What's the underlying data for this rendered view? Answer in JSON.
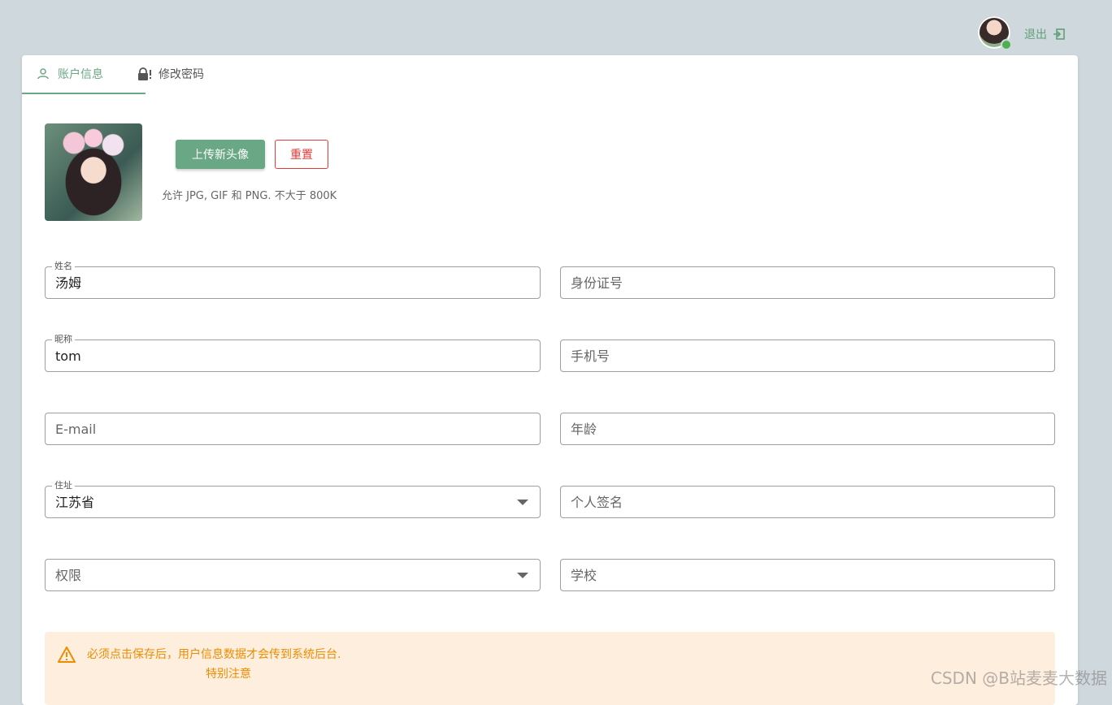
{
  "header": {
    "avatar_icon": "user-avatar",
    "logout_label": "退出",
    "logout_icon": "logout-icon"
  },
  "tabs": [
    {
      "label": "账户信息",
      "icon": "user-icon",
      "active": true
    },
    {
      "label": "修改密码",
      "icon": "lock-icon",
      "active": false
    }
  ],
  "profile": {
    "upload_label": "上传新头像",
    "reset_label": "重置",
    "hint": "允许 JPG, GIF 和 PNG. 不大于 800K"
  },
  "form": {
    "name": {
      "label": "姓名",
      "value": "汤姆"
    },
    "id_card": {
      "placeholder": "身份证号"
    },
    "nickname": {
      "label": "昵称",
      "value": "tom"
    },
    "phone": {
      "placeholder": "手机号"
    },
    "email": {
      "placeholder": "E-mail"
    },
    "age": {
      "placeholder": "年龄"
    },
    "address": {
      "label": "住址",
      "value": "江苏省"
    },
    "signature": {
      "placeholder": "个人签名"
    },
    "permission": {
      "placeholder": "权限"
    },
    "school": {
      "placeholder": "学校"
    }
  },
  "alert": {
    "icon": "warning-icon",
    "text": "必须点击保存后，用户信息数据才会传到系统后台.",
    "sub": "特别注意"
  },
  "watermark": "CSDN @B站麦麦大数据",
  "colors": {
    "primary": "#6aa784",
    "danger": "#e53935",
    "warning": "#ef8c00",
    "alert_bg": "#fdeedd",
    "page_bg": "#cfd8dc"
  }
}
